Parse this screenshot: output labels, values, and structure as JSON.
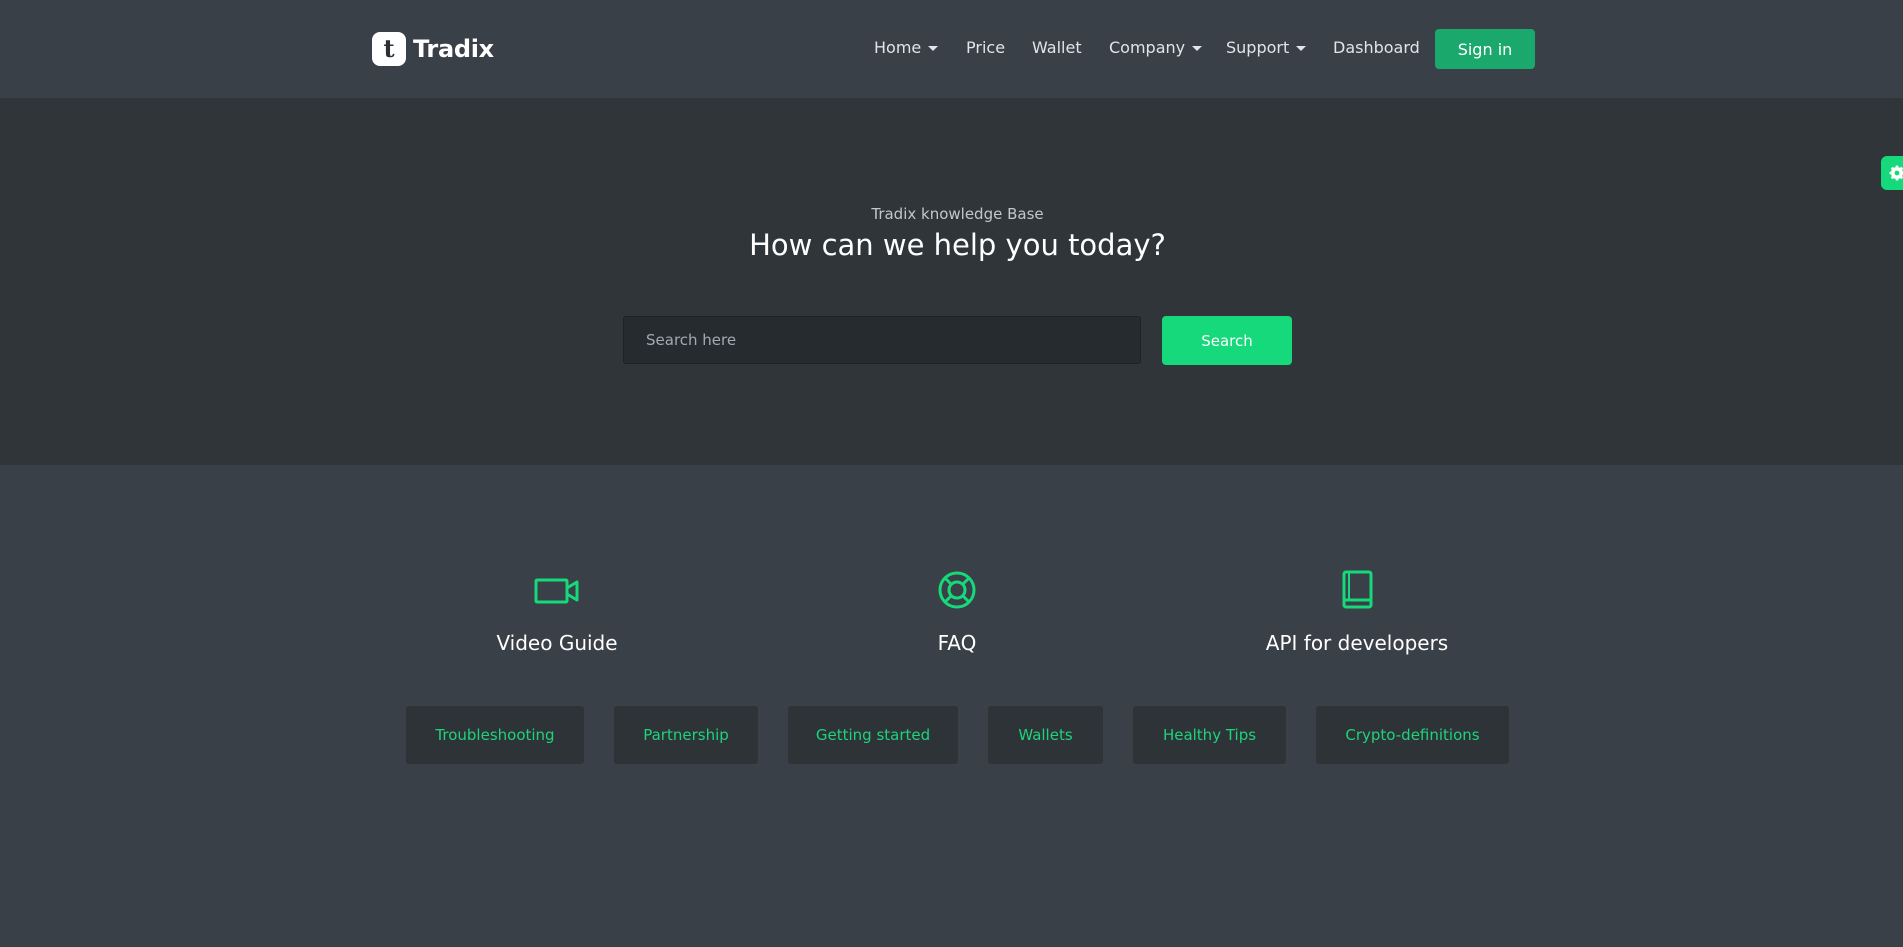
{
  "brand": {
    "logo_letter": "t",
    "name": "Tradix"
  },
  "nav": {
    "items": [
      {
        "label": "Home",
        "dropdown": true
      },
      {
        "label": "Price",
        "dropdown": false
      },
      {
        "label": "Wallet",
        "dropdown": false
      },
      {
        "label": "Company",
        "dropdown": true
      },
      {
        "label": "Support",
        "dropdown": true
      },
      {
        "label": "Dashboard",
        "dropdown": false
      }
    ],
    "signin_label": "Sign in"
  },
  "hero": {
    "subtitle": "Tradix knowledge Base",
    "title": "How can we help you today?",
    "search_placeholder": "Search here",
    "search_value": "",
    "search_button": "Search"
  },
  "features": [
    {
      "icon": "video-camera-icon",
      "title": "Video Guide"
    },
    {
      "icon": "life-ring-icon",
      "title": "FAQ"
    },
    {
      "icon": "book-icon",
      "title": "API for developers"
    }
  ],
  "tags": [
    "Troubleshooting",
    "Partnership",
    "Getting started",
    "Wallets",
    "Healthy Tips",
    "Crypto-definitions"
  ],
  "colors": {
    "accent": "#16d97b",
    "signin": "#1ba86c",
    "header_bg": "#3a4047",
    "hero_bg": "#2f3539",
    "tag_text": "#1ed37b"
  }
}
